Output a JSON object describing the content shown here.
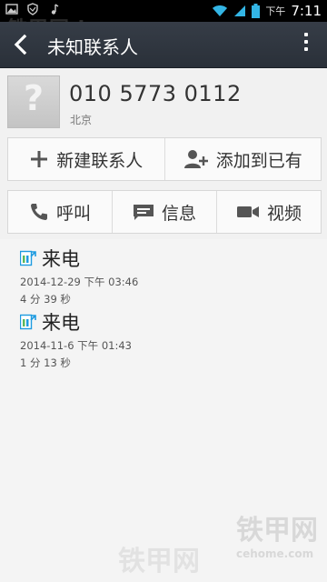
{
  "status_bar": {
    "ampm": "下午",
    "time": "7:11",
    "icons": [
      "image-notification-icon",
      "shield-icon",
      "music-icon",
      "wifi-icon",
      "signal-icon",
      "battery-icon"
    ]
  },
  "watermark": {
    "top": "铁甲网 ieme.com",
    "bottom": "铁甲网",
    "bottom_sub": "cehome.com"
  },
  "action_bar": {
    "title": "未知联系人",
    "back_icon": "back-arrow-icon",
    "overflow_icon": "overflow-menu-icon"
  },
  "contact": {
    "number": "010 5773 0112",
    "location": "北京",
    "avatar_icon": "unknown-contact-icon"
  },
  "actions_top": [
    {
      "label": "新建联系人",
      "icon": "plus-icon"
    },
    {
      "label": "添加到已有",
      "icon": "add-person-icon"
    }
  ],
  "actions_bottom": [
    {
      "label": "呼叫",
      "icon": "phone-icon"
    },
    {
      "label": "信息",
      "icon": "message-icon"
    },
    {
      "label": "视频",
      "icon": "video-icon"
    }
  ],
  "call_log": [
    {
      "type": "来电",
      "date": "2014-12-29 下午 03:46",
      "duration": "4 分 39 秒",
      "icon": "incoming-call-icon"
    },
    {
      "type": "来电",
      "date": "2014-11-6 下午 01:43",
      "duration": "1 分 13 秒",
      "icon": "incoming-call-icon"
    }
  ],
  "colors": {
    "action_bar": "#2f3540",
    "accent_blue": "#1e9be0",
    "incoming_green": "#5cb85c"
  }
}
